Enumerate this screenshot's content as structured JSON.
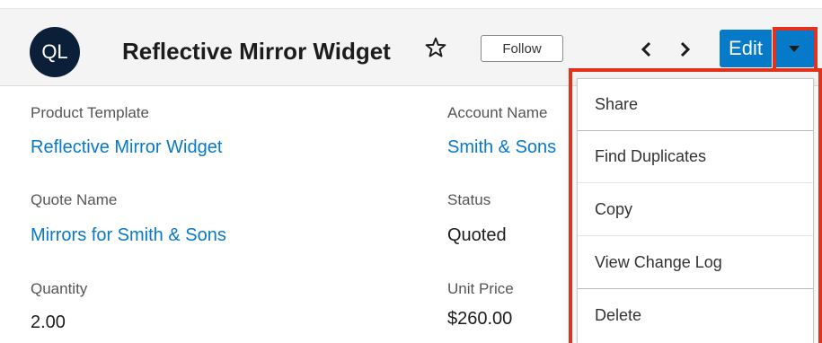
{
  "header": {
    "avatar_initials": "QL",
    "title": "Reflective Mirror Widget",
    "follow_label": "Follow",
    "edit_label": "Edit",
    "icons": [
      "star-icon",
      "chevron-left-icon",
      "chevron-right-icon",
      "caret-down-icon"
    ]
  },
  "fields": {
    "product_template": {
      "label": "Product Template",
      "value": "Reflective Mirror Widget"
    },
    "account_name": {
      "label": "Account Name",
      "value": "Smith & Sons"
    },
    "quote_name": {
      "label": "Quote Name",
      "value": "Mirrors for Smith & Sons"
    },
    "status": {
      "label": "Status",
      "value": "Quoted"
    },
    "quantity": {
      "label": "Quantity",
      "value": "2.00"
    },
    "unit_price": {
      "label": "Unit Price",
      "value": "$260.00"
    }
  },
  "menu": {
    "items": [
      {
        "label": "Share"
      },
      {
        "label": "Find Duplicates"
      },
      {
        "label": "Copy"
      },
      {
        "label": "View Change Log"
      },
      {
        "label": "Delete"
      }
    ]
  },
  "colors": {
    "accent": "#0679c8",
    "highlight": "#e3321c",
    "avatar_bg": "#0b2038"
  }
}
